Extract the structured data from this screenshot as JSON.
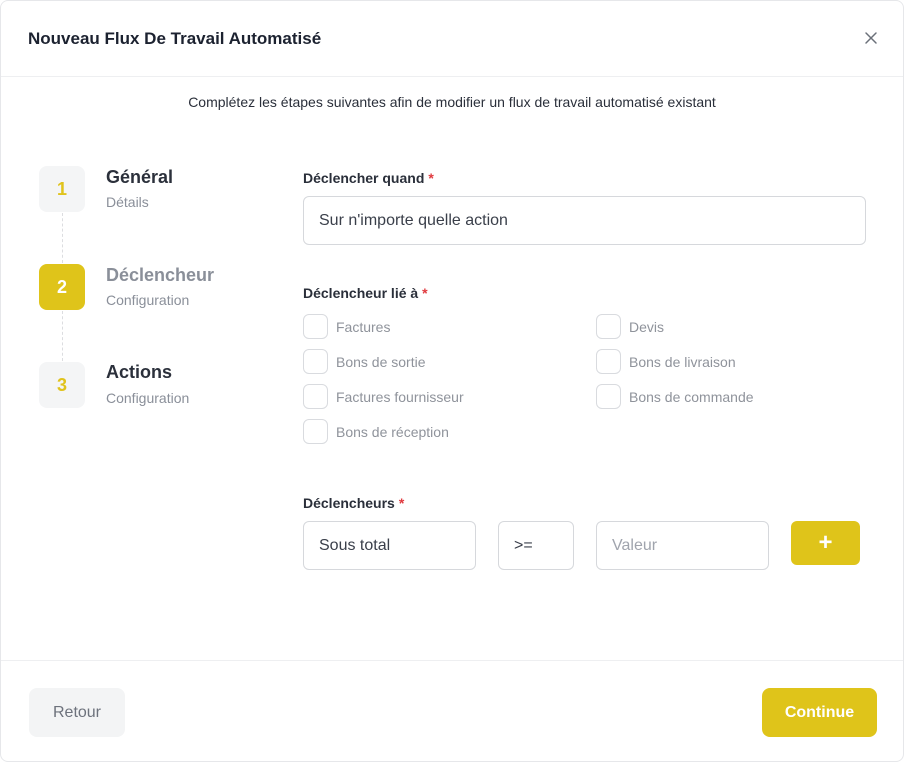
{
  "modal": {
    "title": "Nouveau Flux De Travail Automatisé",
    "subtitle": "Complétez les étapes suivantes afin de modifier un flux de travail automatisé existant",
    "close_icon": "close-icon"
  },
  "steps": [
    {
      "number": "1",
      "title": "Général",
      "subtitle": "Détails",
      "active": false
    },
    {
      "number": "2",
      "title": "Déclencheur",
      "subtitle": "Configuration",
      "active": true
    },
    {
      "number": "3",
      "title": "Actions",
      "subtitle": "Configuration",
      "active": false
    }
  ],
  "form": {
    "trigger_when": {
      "label": "Déclencher quand",
      "required": "*",
      "value": "Sur n'importe quelle action"
    },
    "trigger_linked": {
      "label": "Déclencheur lié à",
      "required": "*",
      "options": [
        "Factures",
        "Devis",
        "Bons de sortie",
        "Bons de livraison",
        "Factures fournisseur",
        "Bons de commande",
        "Bons de réception"
      ]
    },
    "triggers": {
      "label": "Déclencheurs",
      "required": "*",
      "field": "Sous total",
      "operator": ">=",
      "value_placeholder": "Valeur",
      "add_label": "+"
    }
  },
  "footer": {
    "back_label": "Retour",
    "continue_label": "Continue"
  },
  "colors": {
    "accent": "#dfc41a",
    "required": "#e0393e"
  }
}
